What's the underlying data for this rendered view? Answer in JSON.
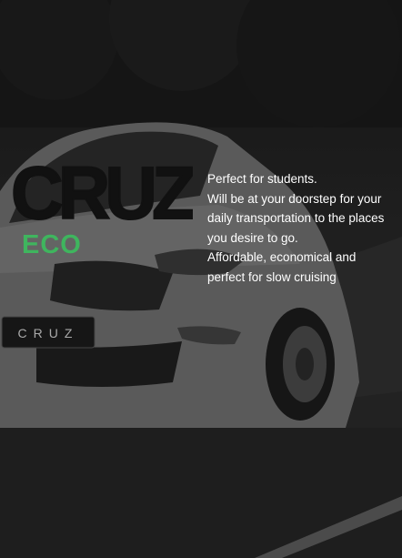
{
  "background": {
    "plate_text": "CRUZ",
    "overlay_color": "#000000"
  },
  "logo": {
    "text": "CRUZ",
    "color": "#111111"
  },
  "tier": {
    "label": "ECO",
    "color": "#3fb55e"
  },
  "description": {
    "line1": "Perfect for students.",
    "line2": "Will be at your doorstep for your daily transportation to the places you desire to go.",
    "line3": "Affordable, economical and perfect for slow cruising"
  }
}
